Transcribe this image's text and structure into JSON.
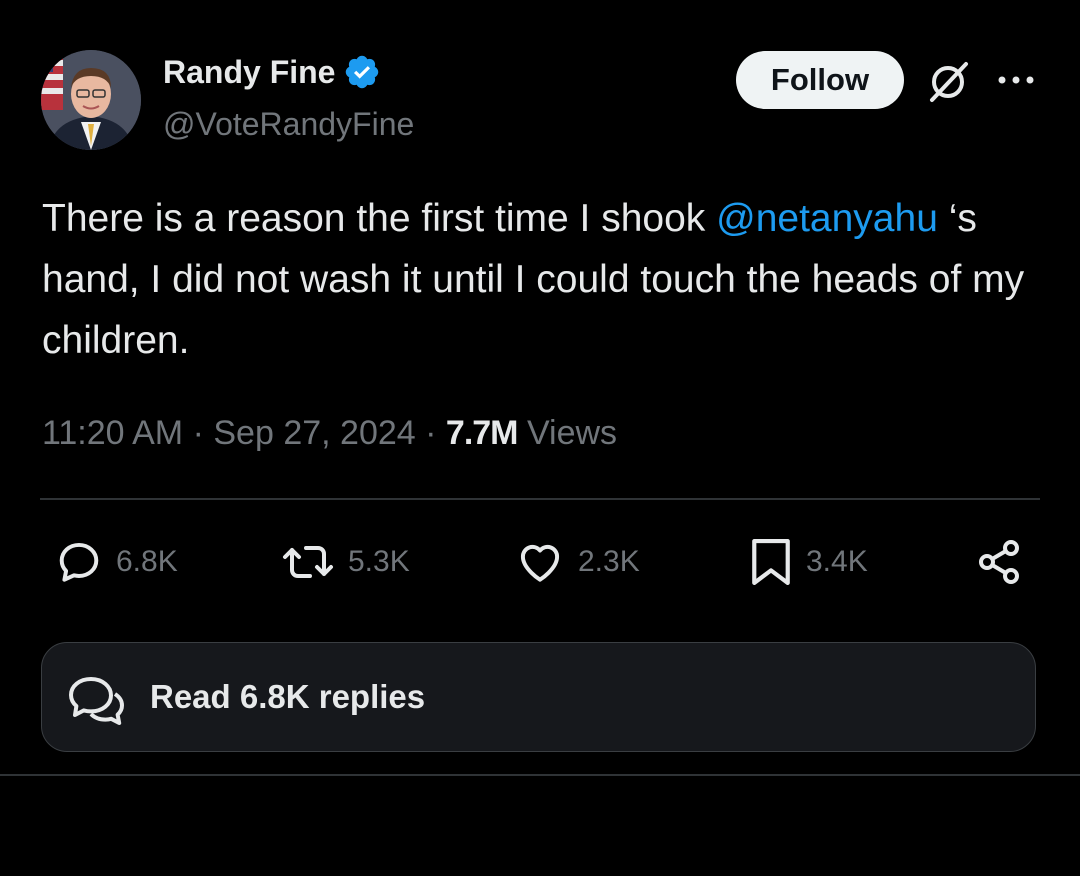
{
  "author": {
    "name": "Randy Fine",
    "handle": "@VoteRandyFine",
    "verified": true
  },
  "header": {
    "follow_label": "Follow",
    "grok_icon": "grok-icon",
    "more_icon": "more-icon"
  },
  "tweet": {
    "text_before": "There is a reason the first time I shook ",
    "mention": "@netanyahu",
    "text_after": " ‘s hand, I did not wash it until I could touch the heads of my children.",
    "time": "11:20 AM",
    "separator": "·",
    "date": "Sep 27, 2024",
    "views_count": "7.7M",
    "views_label": "Views"
  },
  "actions": {
    "replies": "6.8K",
    "reposts": "5.3K",
    "likes": "2.3K",
    "bookmarks": "3.4K"
  },
  "read_replies": {
    "label": "Read 6.8K replies"
  },
  "colors": {
    "background": "#000000",
    "text": "#e7e9ea",
    "secondary": "#71767b",
    "accent": "#1d9bf0",
    "divider": "#2f3336"
  }
}
